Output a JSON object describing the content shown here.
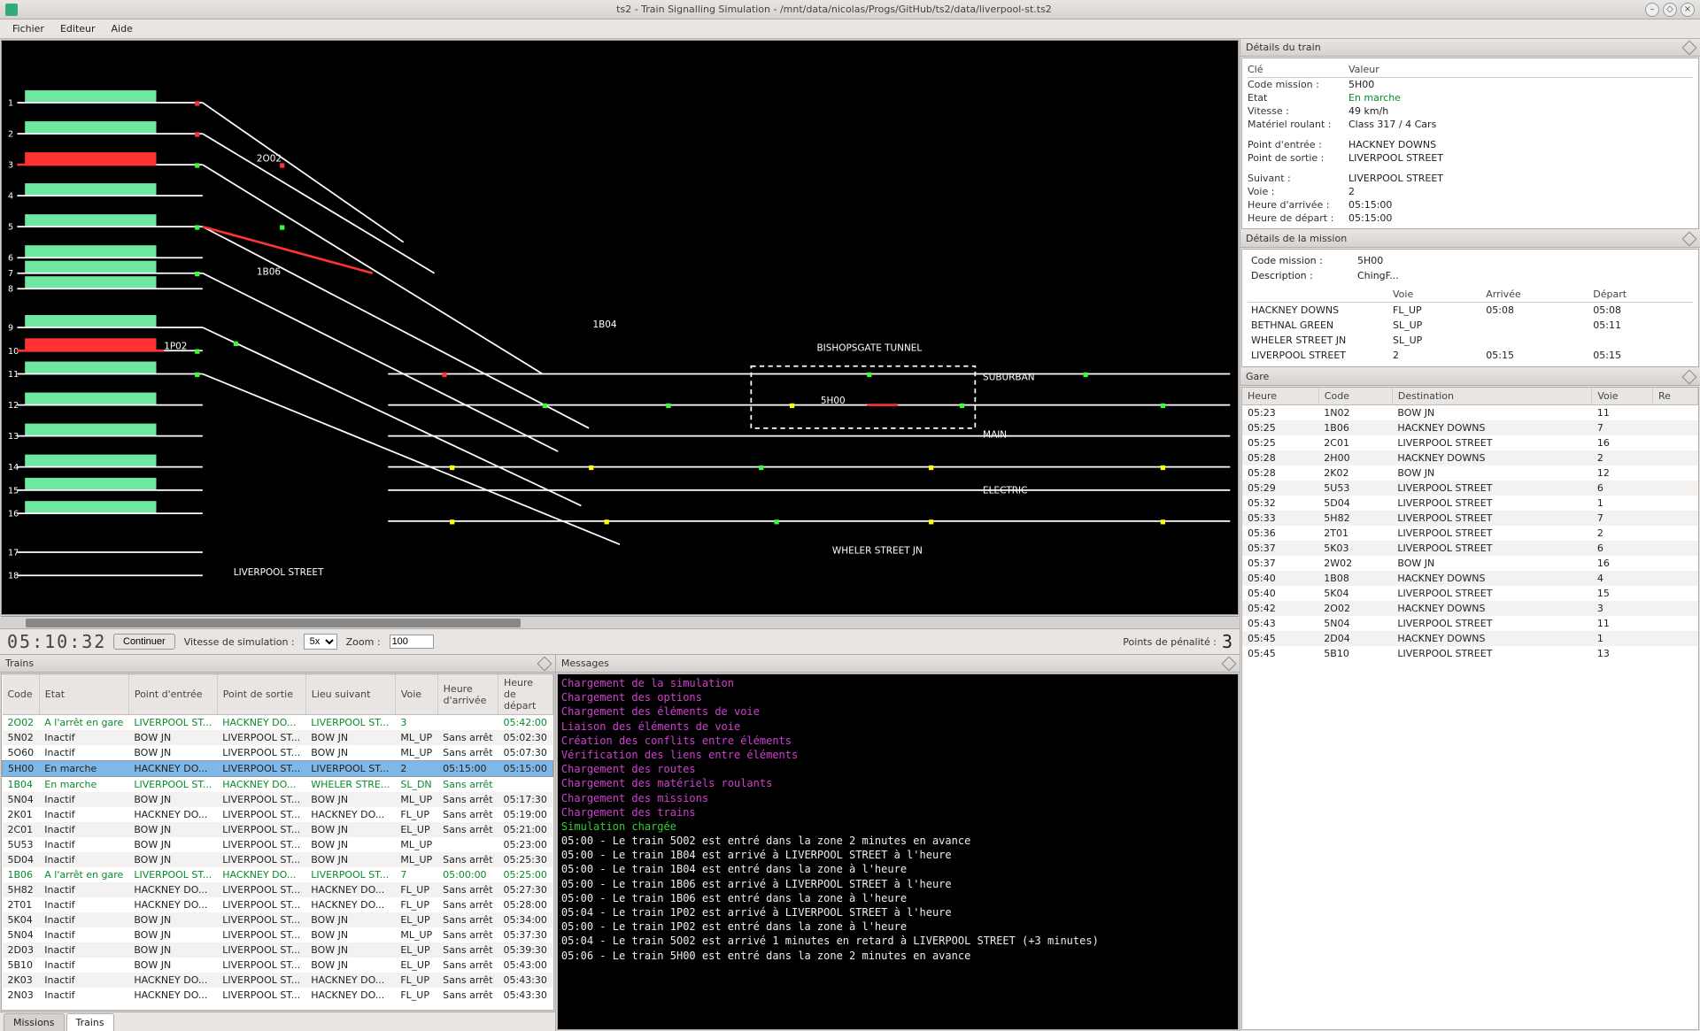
{
  "window": {
    "title": "ts2 - Train Signalling Simulation - /mnt/data/nicolas/Progs/GitHub/ts2/data/liverpool-st.ts2"
  },
  "menu": {
    "items": [
      "Fichier",
      "Editeur",
      "Aide"
    ]
  },
  "track": {
    "platform_numbers": [
      "1",
      "2",
      "3",
      "4",
      "5",
      "6",
      "7",
      "8",
      "9",
      "10",
      "11",
      "12",
      "13",
      "14",
      "15",
      "16",
      "17",
      "18"
    ],
    "berths": [
      "2O02",
      "1B06",
      "1P02",
      "1B04",
      "5H00"
    ],
    "labels": {
      "tunnel": "BISHOPSGATE TUNNEL",
      "suburban": "SUBURBAN",
      "main": "MAIN",
      "electric": "ELECTRIC",
      "wheler": "WHELER STREET JN",
      "station": "LIVERPOOL STREET"
    }
  },
  "sim": {
    "clock": "05:10:32",
    "continue": "Continuer",
    "speed_label": "Vitesse de simulation :",
    "speed_value": "5x",
    "zoom_label": "Zoom :",
    "zoom_value": "100",
    "penalty_label": "Points de pénalité :",
    "penalty_value": "3"
  },
  "trains_dock": {
    "title": "Trains",
    "headers": [
      "Code",
      "Etat",
      "Point d'entrée",
      "Point de sortie",
      "Lieu suivant",
      "Voie",
      "Heure d'arrivée",
      "Heure de départ"
    ],
    "rows": [
      {
        "code": "2O02",
        "etat": "A l'arrêt en gare",
        "entree": "LIVERPOOL ST...",
        "sortie": "HACKNEY DO...",
        "suivant": "LIVERPOOL ST...",
        "voie": "3",
        "arr": "",
        "dep": "05:42:00",
        "cls": "green"
      },
      {
        "code": "5N02",
        "etat": "Inactif",
        "entree": "BOW JN",
        "sortie": "LIVERPOOL ST...",
        "suivant": "BOW JN",
        "voie": "ML_UP",
        "arr": "Sans arrêt",
        "dep": "05:02:30"
      },
      {
        "code": "5O60",
        "etat": "Inactif",
        "entree": "BOW JN",
        "sortie": "LIVERPOOL ST...",
        "suivant": "BOW JN",
        "voie": "ML_UP",
        "arr": "Sans arrêt",
        "dep": "05:07:30"
      },
      {
        "code": "5H00",
        "etat": "En marche",
        "entree": "HACKNEY DO...",
        "sortie": "LIVERPOOL ST...",
        "suivant": "LIVERPOOL ST...",
        "voie": "2",
        "arr": "05:15:00",
        "dep": "05:15:00",
        "cls": "sel"
      },
      {
        "code": "1B04",
        "etat": "En marche",
        "entree": "LIVERPOOL ST...",
        "sortie": "HACKNEY DO...",
        "suivant": "WHELER STRE...",
        "voie": "SL_DN",
        "arr": "Sans arrêt",
        "dep": "",
        "cls": "green"
      },
      {
        "code": "5N04",
        "etat": "Inactif",
        "entree": "BOW JN",
        "sortie": "LIVERPOOL ST...",
        "suivant": "BOW JN",
        "voie": "ML_UP",
        "arr": "Sans arrêt",
        "dep": "05:17:30"
      },
      {
        "code": "2K01",
        "etat": "Inactif",
        "entree": "HACKNEY DO...",
        "sortie": "LIVERPOOL ST...",
        "suivant": "HACKNEY DO...",
        "voie": "FL_UP",
        "arr": "Sans arrêt",
        "dep": "05:19:00"
      },
      {
        "code": "2C01",
        "etat": "Inactif",
        "entree": "BOW JN",
        "sortie": "LIVERPOOL ST...",
        "suivant": "BOW JN",
        "voie": "EL_UP",
        "arr": "Sans arrêt",
        "dep": "05:21:00"
      },
      {
        "code": "5U53",
        "etat": "Inactif",
        "entree": "BOW JN",
        "sortie": "LIVERPOOL ST...",
        "suivant": "BOW JN",
        "voie": "ML_UP",
        "arr": "",
        "dep": "05:23:00"
      },
      {
        "code": "5D04",
        "etat": "Inactif",
        "entree": "BOW JN",
        "sortie": "LIVERPOOL ST...",
        "suivant": "BOW JN",
        "voie": "ML_UP",
        "arr": "Sans arrêt",
        "dep": "05:25:30"
      },
      {
        "code": "1B06",
        "etat": "A l'arrêt en gare",
        "entree": "LIVERPOOL ST...",
        "sortie": "HACKNEY DO...",
        "suivant": "LIVERPOOL ST...",
        "voie": "7",
        "arr": "05:00:00",
        "dep": "05:25:00",
        "cls": "green"
      },
      {
        "code": "5H82",
        "etat": "Inactif",
        "entree": "HACKNEY DO...",
        "sortie": "LIVERPOOL ST...",
        "suivant": "HACKNEY DO...",
        "voie": "FL_UP",
        "arr": "Sans arrêt",
        "dep": "05:27:30"
      },
      {
        "code": "2T01",
        "etat": "Inactif",
        "entree": "HACKNEY DO...",
        "sortie": "LIVERPOOL ST...",
        "suivant": "HACKNEY DO...",
        "voie": "FL_UP",
        "arr": "Sans arrêt",
        "dep": "05:28:00"
      },
      {
        "code": "5K04",
        "etat": "Inactif",
        "entree": "BOW JN",
        "sortie": "LIVERPOOL ST...",
        "suivant": "BOW JN",
        "voie": "EL_UP",
        "arr": "Sans arrêt",
        "dep": "05:34:00"
      },
      {
        "code": "5N04",
        "etat": "Inactif",
        "entree": "BOW JN",
        "sortie": "LIVERPOOL ST...",
        "suivant": "BOW JN",
        "voie": "ML_UP",
        "arr": "Sans arrêt",
        "dep": "05:37:30"
      },
      {
        "code": "2D03",
        "etat": "Inactif",
        "entree": "BOW JN",
        "sortie": "LIVERPOOL ST...",
        "suivant": "BOW JN",
        "voie": "EL_UP",
        "arr": "Sans arrêt",
        "dep": "05:39:30"
      },
      {
        "code": "5B10",
        "etat": "Inactif",
        "entree": "BOW JN",
        "sortie": "LIVERPOOL ST...",
        "suivant": "BOW JN",
        "voie": "EL_UP",
        "arr": "Sans arrêt",
        "dep": "05:43:00"
      },
      {
        "code": "2K03",
        "etat": "Inactif",
        "entree": "HACKNEY DO...",
        "sortie": "LIVERPOOL ST...",
        "suivant": "HACKNEY DO...",
        "voie": "FL_UP",
        "arr": "Sans arrêt",
        "dep": "05:43:30"
      },
      {
        "code": "2N03",
        "etat": "Inactif",
        "entree": "HACKNEY DO...",
        "sortie": "LIVERPOOL ST...",
        "suivant": "HACKNEY DO...",
        "voie": "FL_UP",
        "arr": "Sans arrêt",
        "dep": "05:43:30"
      }
    ],
    "tabs": [
      "Missions",
      "Trains"
    ]
  },
  "messages": {
    "title": "Messages",
    "loading": [
      "Chargement de la simulation",
      "Chargement des options",
      "Chargement des éléments de voie",
      "Liaison des éléments de voie",
      "Création des conflits entre éléments",
      "Vérification des liens entre éléments",
      "Chargement des routes",
      "Chargement des matériels roulants",
      "Chargement des missions",
      "Chargement des trains"
    ],
    "ok": "Simulation chargée",
    "log": [
      "05:00 - Le train 5O02 est entré dans la zone 2 minutes en avance",
      "05:00 - Le train 1B04 est arrivé à LIVERPOOL STREET à l'heure",
      "05:00 - Le train 1B04 est entré dans la zone à l'heure",
      "05:00 - Le train 1B06 est arrivé à LIVERPOOL STREET à l'heure",
      "05:00 - Le train 1B06 est entré dans la zone à l'heure",
      "05:04 - Le train 1P02 est arrivé à LIVERPOOL STREET à l'heure",
      "05:00 - Le train 1P02 est entré dans la zone à l'heure",
      "05:04 - Le train 5O02 est arrivé 1 minutes en retard à LIVERPOOL STREET (+3 minutes)",
      "05:06 - Le train 5H00 est entré dans la zone 2 minutes en avance"
    ]
  },
  "train_details": {
    "title": "Détails du train",
    "head_key": "Clé",
    "head_val": "Valeur",
    "rows": [
      {
        "k": "Code mission :",
        "v": "5H00"
      },
      {
        "k": "Etat",
        "v": "En marche",
        "green": true
      },
      {
        "k": "Vitesse :",
        "v": "49 km/h"
      },
      {
        "k": "Matériel roulant :",
        "v": "Class 317 / 4 Cars"
      }
    ],
    "rows2": [
      {
        "k": "Point d'entrée :",
        "v": "HACKNEY DOWNS"
      },
      {
        "k": "Point de sortie :",
        "v": "LIVERPOOL STREET"
      }
    ],
    "rows3": [
      {
        "k": "Suivant :",
        "v": "LIVERPOOL STREET"
      },
      {
        "k": "Voie :",
        "v": "2"
      },
      {
        "k": "Heure d'arrivée :",
        "v": "05:15:00"
      },
      {
        "k": "Heure de départ :",
        "v": "05:15:00"
      }
    ]
  },
  "mission_details": {
    "title": "Détails de la mission",
    "code_k": "Code mission :",
    "code_v": "5H00",
    "desc_k": "Description :",
    "desc_v": "ChingF...",
    "headers": [
      "",
      "Voie",
      "Arrivée",
      "Départ"
    ],
    "rows": [
      {
        "n": "HACKNEY DOWNS",
        "v": "FL_UP",
        "a": "05:08",
        "d": "05:08"
      },
      {
        "n": "BETHNAL GREEN",
        "v": "SL_UP",
        "a": "",
        "d": "05:11"
      },
      {
        "n": "WHELER STREET JN",
        "v": "SL_UP",
        "a": "",
        "d": ""
      },
      {
        "n": "LIVERPOOL STREET",
        "v": "2",
        "a": "05:15",
        "d": "05:15"
      }
    ]
  },
  "gare": {
    "title": "Gare",
    "headers": [
      "Heure",
      "Code",
      "Destination",
      "Voie",
      "Re"
    ],
    "rows": [
      {
        "h": "05:23",
        "c": "1N02",
        "d": "BOW JN",
        "v": "11"
      },
      {
        "h": "05:25",
        "c": "1B06",
        "d": "HACKNEY DOWNS",
        "v": "7"
      },
      {
        "h": "05:25",
        "c": "2C01",
        "d": "LIVERPOOL STREET",
        "v": "16"
      },
      {
        "h": "05:28",
        "c": "2H00",
        "d": "HACKNEY DOWNS",
        "v": "2"
      },
      {
        "h": "05:28",
        "c": "2K02",
        "d": "BOW JN",
        "v": "12"
      },
      {
        "h": "05:29",
        "c": "5U53",
        "d": "LIVERPOOL STREET",
        "v": "6"
      },
      {
        "h": "05:32",
        "c": "5D04",
        "d": "LIVERPOOL STREET",
        "v": "1"
      },
      {
        "h": "05:33",
        "c": "5H82",
        "d": "LIVERPOOL STREET",
        "v": "7"
      },
      {
        "h": "05:36",
        "c": "2T01",
        "d": "LIVERPOOL STREET",
        "v": "2"
      },
      {
        "h": "05:37",
        "c": "5K03",
        "d": "LIVERPOOL STREET",
        "v": "6"
      },
      {
        "h": "05:37",
        "c": "2W02",
        "d": "BOW JN",
        "v": "16"
      },
      {
        "h": "05:40",
        "c": "1B08",
        "d": "HACKNEY DOWNS",
        "v": "4"
      },
      {
        "h": "05:40",
        "c": "5K04",
        "d": "LIVERPOOL STREET",
        "v": "15"
      },
      {
        "h": "05:42",
        "c": "2O02",
        "d": "HACKNEY DOWNS",
        "v": "3"
      },
      {
        "h": "05:43",
        "c": "5N04",
        "d": "LIVERPOOL STREET",
        "v": "11"
      },
      {
        "h": "05:45",
        "c": "2D04",
        "d": "HACKNEY DOWNS",
        "v": "1"
      },
      {
        "h": "05:45",
        "c": "5B10",
        "d": "LIVERPOOL STREET",
        "v": "13"
      }
    ]
  }
}
